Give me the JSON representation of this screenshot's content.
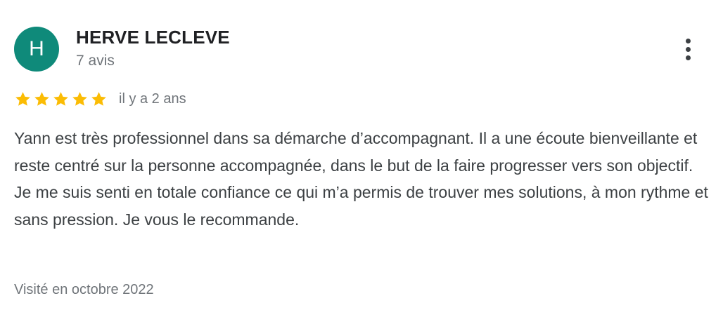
{
  "reviewer": {
    "initial": "H",
    "name": "HERVE LECLEVE",
    "review_count": "7 avis",
    "avatar_color": "#0f8a7a"
  },
  "review": {
    "rating": 5,
    "max_rating": 5,
    "star_color": "#fbbc04",
    "time_ago": "il y a 2 ans",
    "text": "Yann est très professionnel dans sa démarche d’accompagnant. Il a une écoute bienveillante et reste centré sur la personne accompagnée, dans le but de la faire progresser vers son objectif. Je me suis senti en totale confiance ce qui m’a permis de trouver mes solutions, à mon rythme et sans pression. Je vous le recommande.",
    "visit_date": "Visité en octobre 2022"
  },
  "menu": {
    "icon": "more-vert-icon"
  }
}
